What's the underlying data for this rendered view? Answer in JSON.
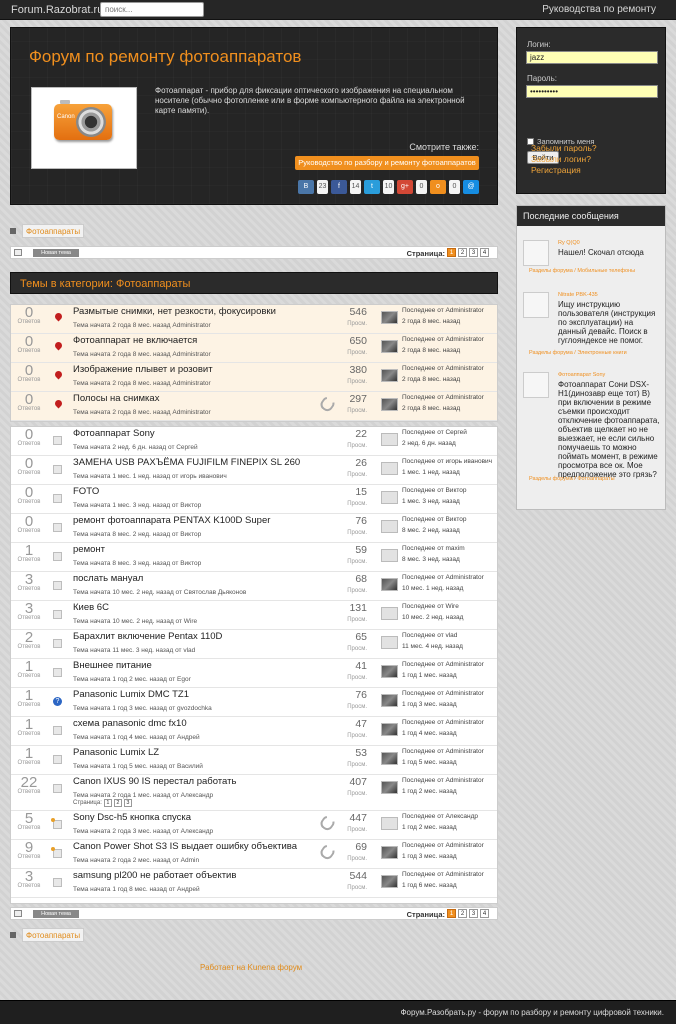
{
  "topbar": {
    "logo": "Forum.Razobrat.ru",
    "search_placeholder": "поиск...",
    "right_link": "Руководства по ремонту"
  },
  "hero": {
    "title": "Форум по ремонту фотоаппаратов",
    "camera_brand": "Canon",
    "description": "Фотоаппарат - прибор для фиксации оптического изображения на специальном носителе (обычно фотопленке или в форме компьютерного файла на электронной карте памяти).",
    "see_also": "Смотрите также:",
    "guide_button": "Руководство по разбору и ремонту фотоаппаратов",
    "shares": [
      {
        "icon": "vk-icon",
        "glyph": "B",
        "count": "23",
        "color": "#4a76a8"
      },
      {
        "icon": "facebook-icon",
        "glyph": "f",
        "count": "14",
        "color": "#3b5998"
      },
      {
        "icon": "twitter-icon",
        "glyph": "t",
        "count": "10",
        "color": "#2a9ddb"
      },
      {
        "icon": "google-plus-icon",
        "glyph": "g+",
        "count": "0",
        "color": "#d34836"
      },
      {
        "icon": "odnoklassniki-icon",
        "glyph": "o",
        "count": "0",
        "color": "#f08f1e"
      },
      {
        "icon": "mailru-icon",
        "glyph": "@",
        "count": "",
        "color": "#168de2"
      }
    ]
  },
  "login": {
    "login_label": "Логин:",
    "login_value": "jazz",
    "password_label": "Пароль:",
    "password_value": "••••••••••",
    "remember": "Запомнить меня",
    "submit": "Войти",
    "links": [
      "Забыли пароль?",
      "Забыли логин?",
      "Регистрация"
    ]
  },
  "recent": {
    "title": "Последние сообщения",
    "items": [
      {
        "author": "Ry Q(Q0",
        "text": "Нашел! Скочал отсюда",
        "category": "Разделы форума / Мобильные телефоны"
      },
      {
        "author": "Nitrate PBK-435",
        "text": "Ищу инструкцию пользователя (инструкция по эксплуатации) на данный девайс. Поиск в гуглояндексе не помог.",
        "category": "Разделы форума / Электронные книги"
      },
      {
        "author": "Фотоаппарат Sony",
        "text": "Фотоаппарат Сони DSX-H1(динозавр еще тот) В) при включении в режиме съемки происходит отключение фотоаппарата, объектив щелкает но не выезжает, не если сильно помучаешь то можно поймать момент, в режиме просмотра все ок. Мое предположение это грязь?",
        "category": "Разделы форума / Фотоаппараты"
      }
    ]
  },
  "breadcrumb": "Фотоаппараты",
  "toolbar": {
    "new_topic": "Новая тема",
    "pages_label": "Страница:",
    "pages": [
      "1",
      "2",
      "3",
      "4"
    ],
    "current_page": "1"
  },
  "category_title": "Темы в категории: Фотоаппараты",
  "replies_label": "Ответов",
  "views_label": "Просм.",
  "sticky_topics": [
    {
      "replies": "0",
      "title": "Размытые снимки, нет резкости, фокусировки",
      "meta": "Тема начата 2 года 8 мес. назад Administrator",
      "views": "546",
      "last": "Последнее от Administrator",
      "date": "2 года 8 мес. назад",
      "icon": "pin",
      "attach": false,
      "avatar": "img"
    },
    {
      "replies": "0",
      "title": "Фотоаппарат не включается",
      "meta": "Тема начата 2 года 8 мес. назад Administrator",
      "views": "650",
      "last": "Последнее от Administrator",
      "date": "2 года 8 мес. назад",
      "icon": "pin",
      "attach": false,
      "avatar": "img"
    },
    {
      "replies": "0",
      "title": "Изображение плывет и розовит",
      "meta": "Тема начата 2 года 8 мес. назад Administrator",
      "views": "380",
      "last": "Последнее от Administrator",
      "date": "2 года 8 мес. назад",
      "icon": "pin",
      "attach": false,
      "avatar": "img"
    },
    {
      "replies": "0",
      "title": "Полосы на снимках",
      "meta": "Тема начата 2 года 8 мес. назад Administrator",
      "views": "297",
      "last": "Последнее от Administrator",
      "date": "2 года 8 мес. назад",
      "icon": "pin",
      "attach": true,
      "avatar": "img"
    }
  ],
  "topics": [
    {
      "replies": "0",
      "title": "Фотоаппарат Sony",
      "meta": "Тема начата 2 нед. 6 дн. назад от Сергей",
      "views": "22",
      "last": "Последнее от Сергей",
      "date": "2 нед. 6 дн. назад",
      "icon": "doc",
      "attach": false,
      "avatar": "blank"
    },
    {
      "replies": "0",
      "title": "ЗАМЕНА USB РАХЪЁМА FUJIFILM FINEPIX SL 260",
      "meta": "Тема начата 1 мес. 1 нед. назад от игорь иванович",
      "views": "26",
      "last": "Последнее от игорь иванович",
      "date": "1 мес. 1 нед. назад",
      "icon": "doc",
      "attach": false,
      "avatar": "blank"
    },
    {
      "replies": "0",
      "title": "FOTO",
      "meta": "Тема начата 1 мес. 3 нед. назад от Виктор",
      "views": "15",
      "last": "Последнее от Виктор",
      "date": "1 мес. 3 нед. назад",
      "icon": "doc",
      "attach": false,
      "avatar": "blank"
    },
    {
      "replies": "0",
      "title": "ремонт фотоаппарата PENTAX K100D Super",
      "meta": "Тема начата 8 мес. 2 нед. назад от Виктор",
      "views": "76",
      "last": "Последнее от Виктор",
      "date": "8 мес. 2 нед. назад",
      "icon": "doc",
      "attach": false,
      "avatar": "blank"
    },
    {
      "replies": "1",
      "title": "ремонт",
      "meta": "Тема начата 8 мес. 3 нед. назад от Виктор",
      "views": "59",
      "last": "Последнее от maxim",
      "date": "8 мес. 3 нед. назад",
      "icon": "doc",
      "attach": false,
      "avatar": "blank"
    },
    {
      "replies": "3",
      "title": "послать мануал",
      "meta": "Тема начата 10 мес. 2 нед. назад от Святослав Дьяконов",
      "views": "68",
      "last": "Последнее от Administrator",
      "date": "10 мес. 1 нед. назад",
      "icon": "doc",
      "attach": false,
      "avatar": "img"
    },
    {
      "replies": "3",
      "title": "Киев 6С",
      "meta": "Тема начата 10 мес. 2 нед. назад от Wire",
      "views": "131",
      "last": "Последнее от Wire",
      "date": "10 мес. 2 нед. назад",
      "icon": "doc",
      "attach": false,
      "avatar": "blank"
    },
    {
      "replies": "2",
      "title": "Барахлит включение Pentax 110D",
      "meta": "Тема начата 11 мес. 3 нед. назад от vlad",
      "views": "65",
      "last": "Последнее от vlad",
      "date": "11 мес. 4 нед. назад",
      "icon": "doc",
      "attach": false,
      "avatar": "blank"
    },
    {
      "replies": "1",
      "title": "Внешнее питание",
      "meta": "Тема начата 1 год 2 мес. назад от Egor",
      "views": "41",
      "last": "Последнее от Administrator",
      "date": "1 год 1 мес. назад",
      "icon": "doc",
      "attach": false,
      "avatar": "img"
    },
    {
      "replies": "1",
      "title": "Panasonic Lumix DMC TZ1",
      "meta": "Тема начата 1 год 3 мес. назад от gvozdochka",
      "views": "76",
      "last": "Последнее от Administrator",
      "date": "1 год 3 мес. назад",
      "icon": "q",
      "attach": false,
      "avatar": "img"
    },
    {
      "replies": "1",
      "title": "схема panasonic dmc fx10",
      "meta": "Тема начата 1 год 4 мес. назад от Андрей",
      "views": "47",
      "last": "Последнее от Administrator",
      "date": "1 год 4 мес. назад",
      "icon": "doc",
      "attach": false,
      "avatar": "img"
    },
    {
      "replies": "1",
      "title": "Panasonic Lumix LZ",
      "meta": "Тема начата 1 год 5 мес. назад от Василий",
      "views": "53",
      "last": "Последнее от Administrator",
      "date": "1 год 5 мес. назад",
      "icon": "doc",
      "attach": false,
      "avatar": "img"
    },
    {
      "replies": "22",
      "title": "Canon IXUS 90 IS перестал работать",
      "meta": "Тема начата 2 года 1 мес. назад от Александр",
      "views": "407",
      "last": "Последнее от Administrator",
      "date": "1 год 2 мес. назад",
      "icon": "doc",
      "attach": false,
      "avatar": "img",
      "subpages": {
        "label": "Страница:",
        "pages": [
          "1",
          "2",
          "3"
        ]
      }
    },
    {
      "replies": "5",
      "title": "Sony Dsc-h5 кнопка спуска",
      "meta": "Тема начата 2 года 3 мес. назад от Александр",
      "views": "447",
      "last": "Последнее от Александр",
      "date": "1 год 2 мес. назад",
      "icon": "docpin",
      "attach": true,
      "avatar": "blank"
    },
    {
      "replies": "9",
      "title": "Canon Power Shot S3 IS выдает ошибку объектива",
      "meta": "Тема начата 2 года 2 мес. назад от Admin",
      "views": "69",
      "last": "Последнее от Administrator",
      "date": "1 год 3 мес. назад",
      "icon": "docpin",
      "attach": true,
      "avatar": "img"
    },
    {
      "replies": "3",
      "title": "samsung pl200 не работает объектив",
      "meta": "Тема начата 1 год 8 мес. назад от Андрей",
      "views": "544",
      "last": "Последнее от Administrator",
      "date": "1 год 6 мес. назад",
      "icon": "doc",
      "attach": false,
      "avatar": "img"
    }
  ],
  "powered_by": "Работает на Kunena форум",
  "footer": "Форум.Разобрать.ру - форум по разбору и ремонту цифровой техники."
}
